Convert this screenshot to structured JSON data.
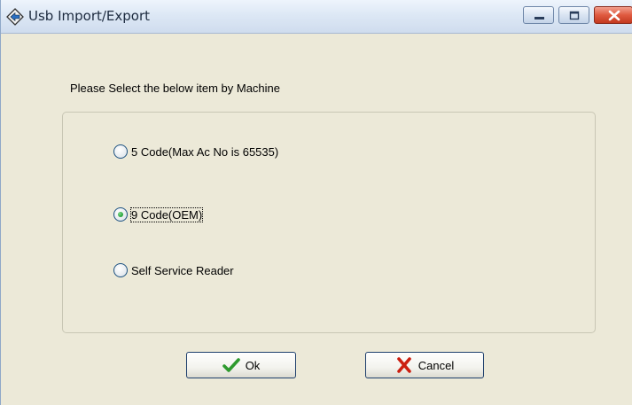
{
  "window": {
    "title": "Usb Import/Export",
    "icons": {
      "app": "usb-arrows-icon",
      "minimize": "minimize-icon",
      "maximize": "maximize-icon",
      "close": "close-icon"
    }
  },
  "dialog": {
    "prompt": "Please Select the below item by Machine",
    "options": [
      {
        "label": "5 Code(Max Ac No is 65535)",
        "checked": false
      },
      {
        "label": "9 Code(OEM)",
        "checked": true
      },
      {
        "label": "Self Service Reader",
        "checked": false
      }
    ],
    "ok_label": "Ok",
    "ok_icon": "checkmark-icon",
    "cancel_label": "Cancel",
    "cancel_icon": "x-mark-icon"
  },
  "colors": {
    "window_bg": "#ece9d8",
    "check_green": "#2e9a2e",
    "cancel_red": "#cc1f10"
  }
}
